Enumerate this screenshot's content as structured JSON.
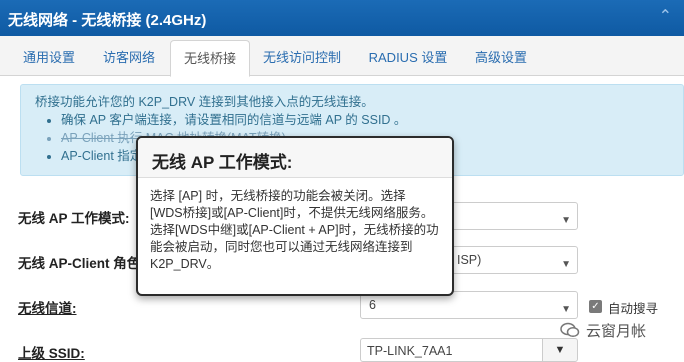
{
  "header": {
    "title": "无线网络 - 无线桥接 (2.4GHz)"
  },
  "tabs": [
    "通用设置",
    "访客网络",
    "无线桥接",
    "无线访问控制",
    "RADIUS 设置",
    "高级设置"
  ],
  "info": {
    "line1": "桥接功能允许您的 K2P_DRV 连接到其他接入点的无线连接。",
    "bullets": [
      "确保 AP 客户端连接，请设置相同的信道与远端 AP 的 SSID 。",
      "AP-Client 执行 MAC 地址转换(MAT转换)",
      "AP-Client 指定"
    ]
  },
  "form": {
    "mode_label": "无线 AP 工作模式:",
    "role_label": "无线 AP-Client 角色",
    "role_value_tail": "ISP)",
    "channel_label": "无线信道:",
    "channel_value": "6",
    "auto_search": "自动搜寻",
    "ssid_label": "上级 SSID:",
    "ssid_value": "TP-LINK_7AA1"
  },
  "popover": {
    "title": "无线 AP 工作模式:",
    "body": "选择 [AP] 时，无线桥接的功能会被关闭。选择 [WDS桥接]或[AP-Client]时，不提供无线网络服务。选择[WDS中继]或[AP-Client + AP]时，无线桥接的功能会被启动，同时您也可以通过无线网络连接到 K2P_DRV。"
  },
  "watermark": {
    "text": "云窗月帐"
  },
  "colors": {
    "header": "#0f5aa3",
    "link": "#2a6db0",
    "info_bg": "#d8edf7"
  }
}
